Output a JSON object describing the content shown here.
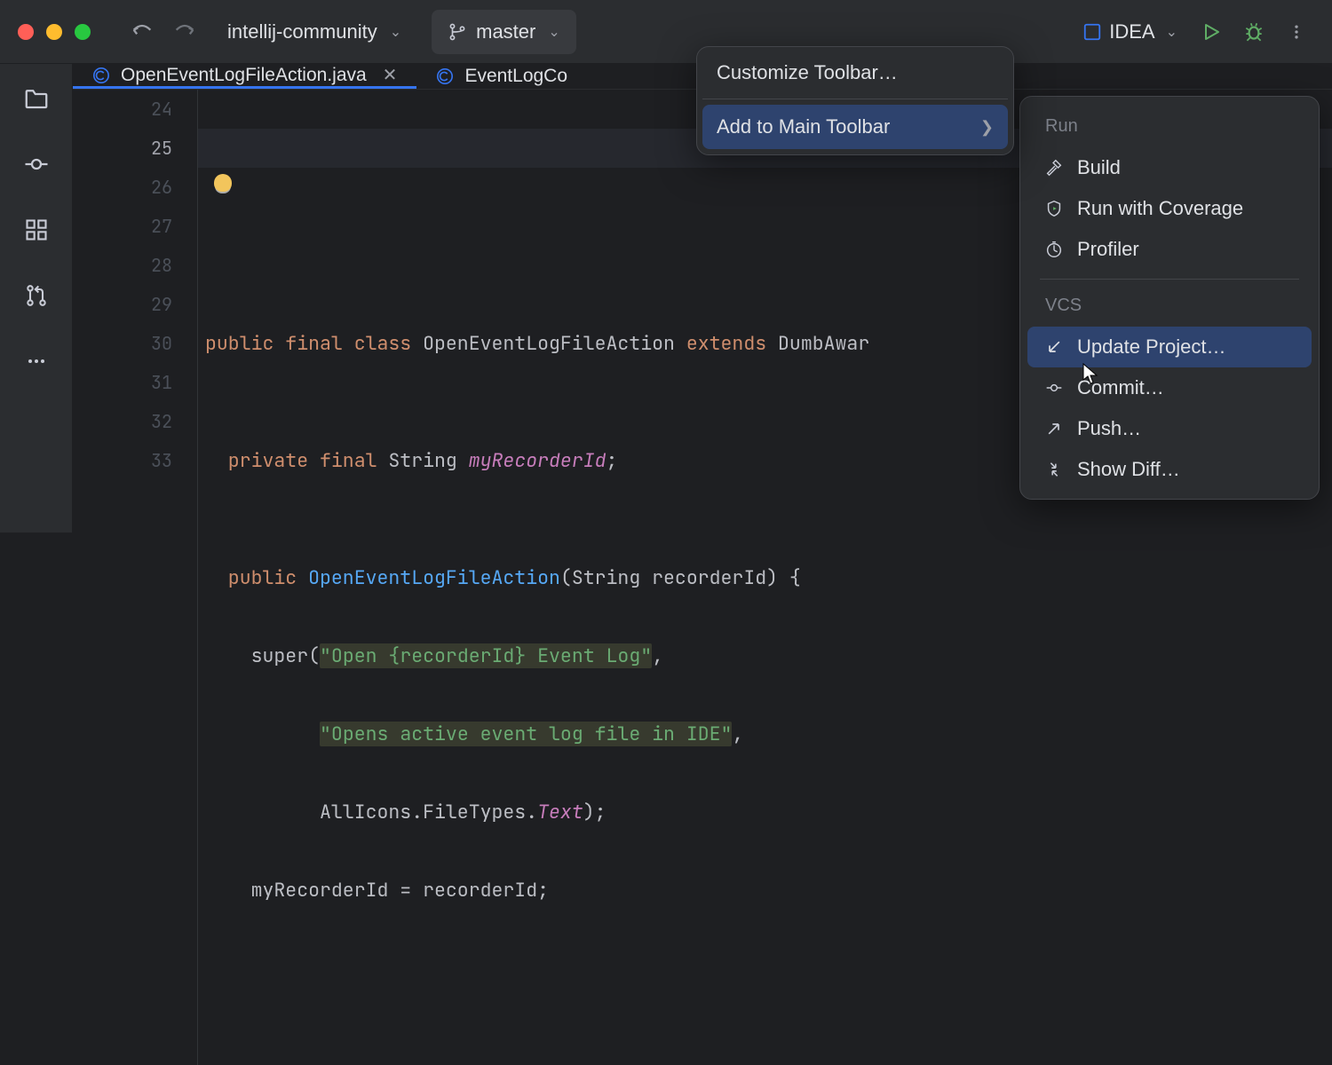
{
  "titlebar": {
    "project": "intellij-community",
    "branch": "master",
    "run_config": "IDEA"
  },
  "tabs": [
    {
      "name": "OpenEventLogFileAction.java",
      "active": true
    },
    {
      "name": "EventLogCo",
      "active": false
    }
  ],
  "gutter": {
    "start": 24,
    "current": 25,
    "lines": [
      24,
      25,
      26,
      27,
      28,
      29,
      30,
      31,
      32,
      33
    ]
  },
  "code": {
    "l24": "",
    "l25a": "public final class ",
    "l25b": "OpenEventLogFileAction ",
    "l25c": "extends ",
    "l25d": "DumbAwar",
    "l26": "",
    "l27a": "  private final ",
    "l27b": "String ",
    "l27c": "myRecorderId",
    "l27d": ";",
    "l28": "",
    "l29a": "  public ",
    "l29b": "OpenEventLogFileAction",
    "l29c": "(String recorderId) {",
    "l30a": "    super(",
    "l30b": "\"Open {recorderId} Event Log\"",
    "l30c": ",",
    "l31a": "          ",
    "l31b": "\"Opens active event log file in IDE\"",
    "l31c": ",",
    "l32a": "          AllIcons.FileTypes.",
    "l32b": "Text",
    "l32c": ");",
    "l33": "    myRecorderId = recorderId;"
  },
  "popover1": {
    "customize": "Customize Toolbar…",
    "add": "Add to Main Toolbar"
  },
  "popover2": {
    "run_head": "Run",
    "build": "Build",
    "coverage": "Run with Coverage",
    "profiler": "Profiler",
    "vcs_head": "VCS",
    "update": "Update Project…",
    "commit": "Commit…",
    "push": "Push…",
    "diff": "Show Diff…"
  }
}
